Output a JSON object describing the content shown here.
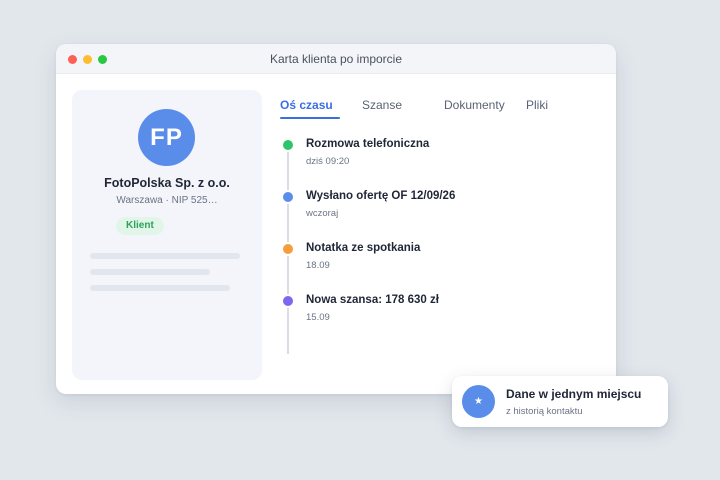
{
  "window": {
    "title": "Karta klienta po imporcie"
  },
  "client_card": {
    "avatar_initials": "FP",
    "company_name": "FotoPolska Sp. z o.o.",
    "subtitle": "Warszawa · NIP 525…",
    "badge": "Klient"
  },
  "tabs": [
    {
      "label": "Oś czasu",
      "active": true
    },
    {
      "label": "Szanse",
      "active": false
    },
    {
      "label": "Dokumenty",
      "active": false
    },
    {
      "label": "Pliki",
      "active": false
    }
  ],
  "timeline": [
    {
      "title": "Rozmowa telefoniczna",
      "time": "dziś 09:20",
      "color": "#2ec46b"
    },
    {
      "title": "Wysłano ofertę OF 12/09/26",
      "time": "wczoraj",
      "color": "#5a8de9"
    },
    {
      "title": "Notatka ze spotkania",
      "time": "18.09",
      "color": "#f59d3d"
    },
    {
      "title": "Nowa szansa: 178 630 zł",
      "time": "15.09",
      "color": "#7b68ee"
    }
  ],
  "toast": {
    "icon": "star-icon",
    "title": "Dane w jednym miejscu",
    "subtitle": "z historią kontaktu"
  },
  "colors": {
    "accent": "#3b6fe0",
    "avatar": "#5a8de9",
    "badge_text": "#2ca35a",
    "badge_bg": "#e1f6e8"
  }
}
